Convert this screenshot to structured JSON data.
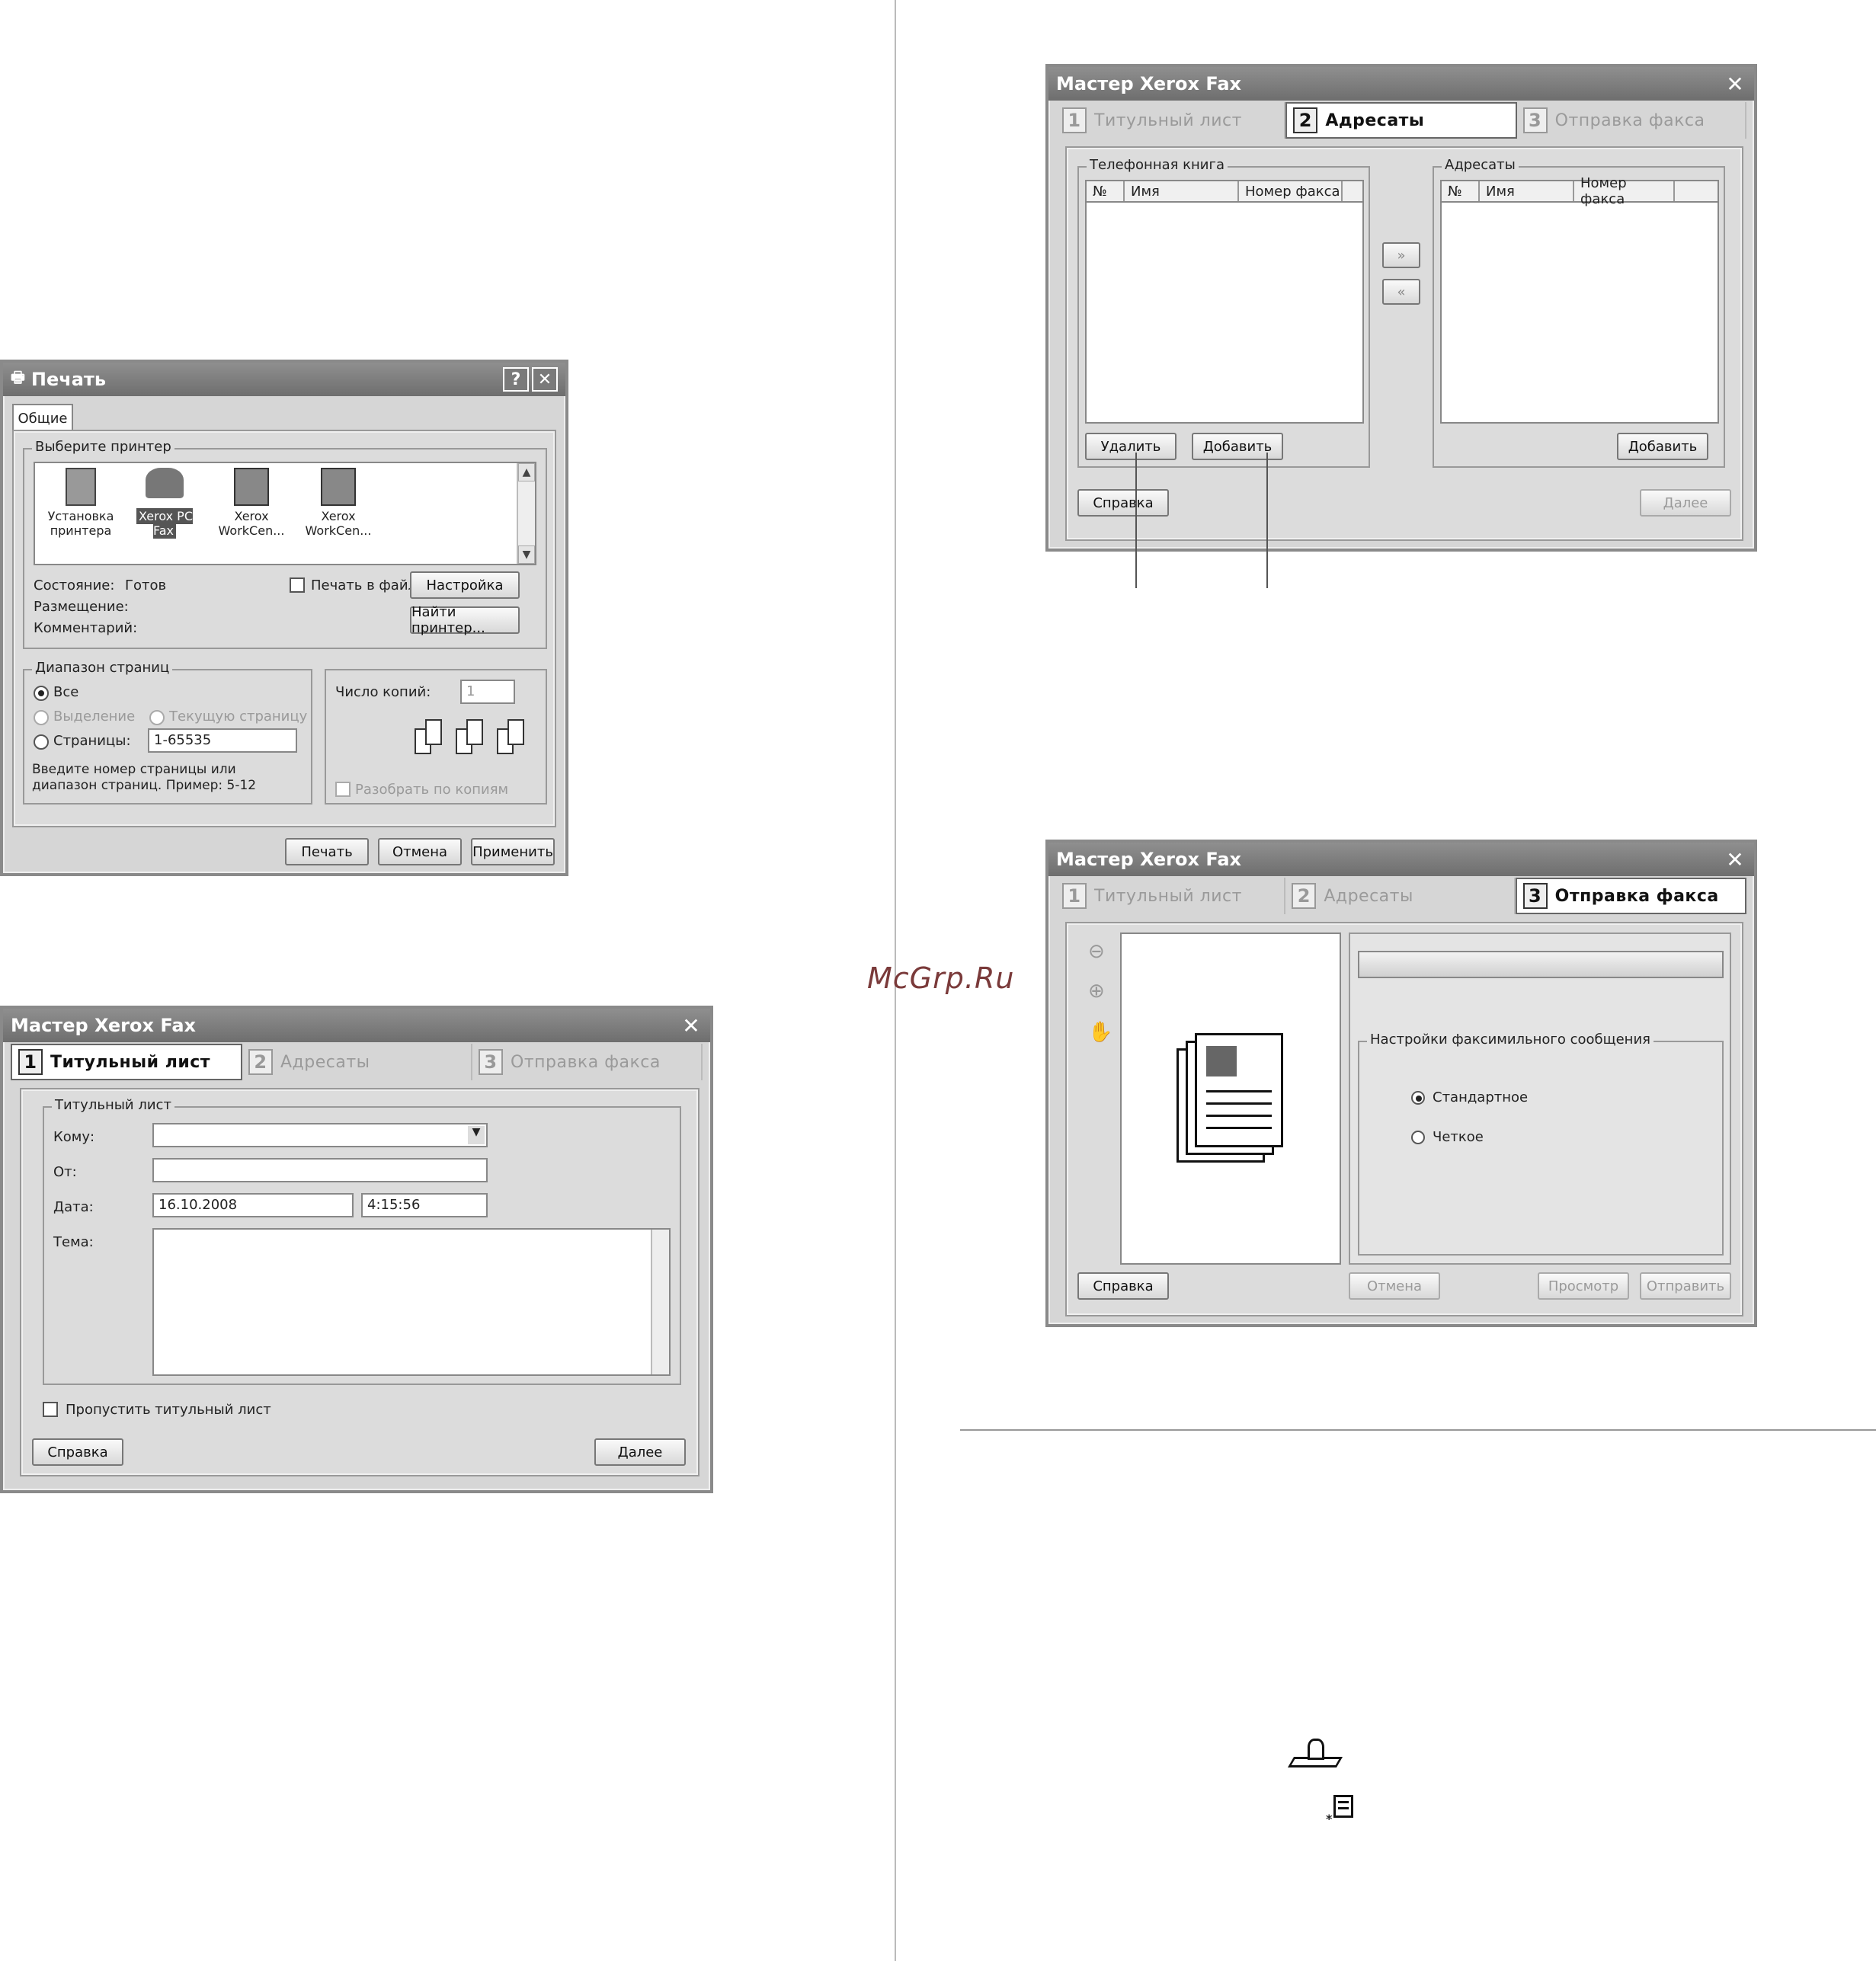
{
  "watermark": "McGrp.Ru",
  "print": {
    "title": "Печать",
    "help": "?",
    "close": "✕",
    "tab": "Общие",
    "select_printer": "Выберите принтер",
    "printers": [
      "Установка принтера",
      "Xerox PC Fax",
      "Xerox WorkCen...",
      "Xerox WorkCen..."
    ],
    "status_label": "Состояние:",
    "status_value": "Готов",
    "location_label": "Размещение:",
    "comment_label": "Комментарий:",
    "print_to_file": "Печать в файл",
    "settings": "Настройка",
    "find_printer": "Найти принтер...",
    "page_range": "Диапазон страниц",
    "all": "Все",
    "selection": "Выделение",
    "current_page": "Текущую страницу",
    "pages": "Страницы:",
    "pages_value": "1-65535",
    "hint": "Введите номер страницы или диапазон страниц.  Пример: 5-12",
    "copies_label": "Число копий:",
    "copies_value": "1",
    "collate": "Разобрать по копиям",
    "btn_print": "Печать",
    "btn_cancel": "Отмена",
    "btn_apply": "Применить"
  },
  "wizard_title": "Мастер Xerox Fax",
  "wizard_close": "✕",
  "tabs": [
    {
      "n": "1",
      "label": "Титульный лист"
    },
    {
      "n": "2",
      "label": "Адресаты"
    },
    {
      "n": "3",
      "label": "Отправка факса"
    }
  ],
  "cover": {
    "group": "Титульный лист",
    "to": "Кому:",
    "from": "От:",
    "date": "Дата:",
    "date_value": "16.10.2008",
    "time_value": "4:15:56",
    "subject": "Тема:",
    "skip": "Пропустить титульный лист",
    "help": "Справка",
    "next": "Далее"
  },
  "recipients": {
    "phonebook": "Телефонная книга",
    "recipients": "Адресаты",
    "col_no": "№",
    "col_name": "Имя",
    "col_fax": "Номер факса",
    "add_all": "»",
    "remove_all": "«",
    "delete": "Удалить",
    "add": "Добавить",
    "add2": "Добавить",
    "help": "Справка",
    "next": "Далее"
  },
  "send": {
    "settings": "Настройки факсимильного сообщения",
    "standard": "Стандартное",
    "fine": "Четкое",
    "help": "Справка",
    "cancel": "Отмена",
    "preview": "Просмотр",
    "send": "Отправить"
  }
}
